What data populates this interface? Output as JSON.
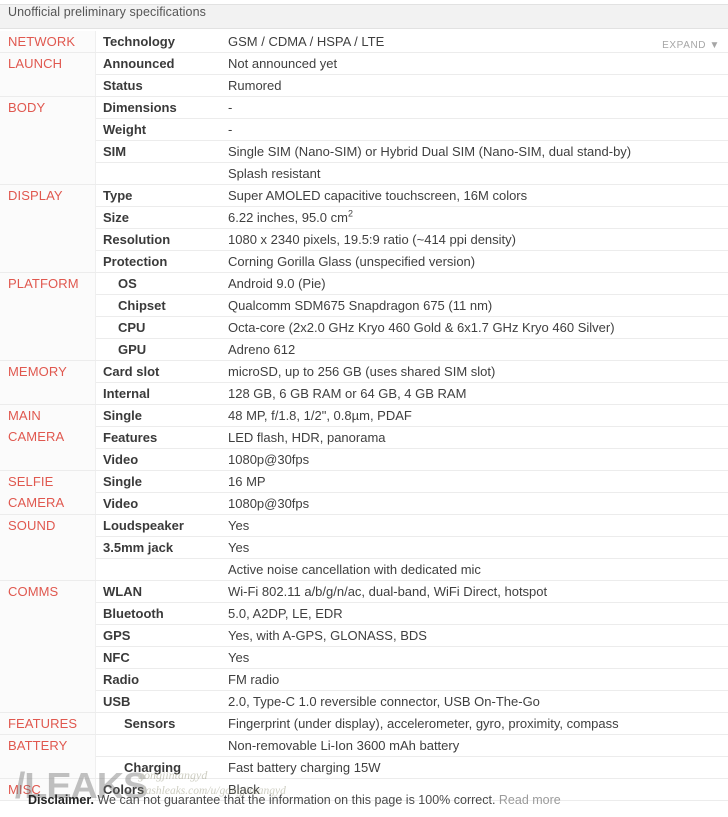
{
  "header": {
    "title": "Unofficial preliminary specifications",
    "expand_label": "EXPAND ▼"
  },
  "colors": {
    "category_red": "#e0584f",
    "header_bg": "#f2f2f2",
    "row_divider": "#ececec",
    "link_grey": "#9b9b9b"
  },
  "sections": [
    {
      "category": "NETWORK",
      "rows": [
        {
          "label": "Technology",
          "value": "GSM / CDMA / HSPA / LTE"
        }
      ]
    },
    {
      "category": "LAUNCH",
      "rows": [
        {
          "label": "Announced",
          "value": "Not announced yet"
        },
        {
          "label": "Status",
          "value": "Rumored"
        }
      ]
    },
    {
      "category": "BODY",
      "rows": [
        {
          "label": "Dimensions",
          "value": "-"
        },
        {
          "label": "Weight",
          "value": "-"
        },
        {
          "label": "SIM",
          "value": "Single SIM (Nano-SIM) or Hybrid Dual SIM (Nano-SIM, dual stand-by)"
        },
        {
          "label": "",
          "value": "Splash resistant"
        }
      ]
    },
    {
      "category": "DISPLAY",
      "rows": [
        {
          "label": "Type",
          "value": "Super AMOLED capacitive touchscreen, 16M colors"
        },
        {
          "label": "Size",
          "value": "6.22 inches, 95.0 cm",
          "superscript": "2"
        },
        {
          "label": "Resolution",
          "value": "1080 x 2340 pixels, 19.5:9 ratio (~414 ppi density)"
        },
        {
          "label": "Protection",
          "value": "Corning Gorilla Glass (unspecified version)"
        }
      ]
    },
    {
      "category": "PLATFORM",
      "rows": [
        {
          "label": "OS",
          "value": "Android 9.0 (Pie)"
        },
        {
          "label": "Chipset",
          "value": "Qualcomm SDM675 Snapdragon 675 (11 nm)"
        },
        {
          "label": "CPU",
          "value": "Octa-core (2x2.0 GHz Kryo 460 Gold & 6x1.7 GHz Kryo 460 Silver)"
        },
        {
          "label": "GPU",
          "value": "Adreno 612"
        }
      ]
    },
    {
      "category": "MEMORY",
      "rows": [
        {
          "label": "Card slot",
          "value": "microSD, up to 256 GB (uses shared SIM slot)"
        },
        {
          "label": "Internal",
          "value": "128 GB, 6 GB RAM or 64 GB, 4 GB RAM"
        }
      ]
    },
    {
      "category": "MAIN CAMERA",
      "rows": [
        {
          "label": "Single",
          "value": "48 MP, f/1.8, 1/2\", 0.8µm, PDAF"
        },
        {
          "label": "Features",
          "value": "LED flash, HDR, panorama"
        },
        {
          "label": "Video",
          "value": "1080p@30fps"
        }
      ]
    },
    {
      "category": "SELFIE CAMERA",
      "rows": [
        {
          "label": "Single",
          "value": "16 MP"
        },
        {
          "label": "Video",
          "value": "1080p@30fps"
        }
      ]
    },
    {
      "category": "SOUND",
      "rows": [
        {
          "label": "Loudspeaker",
          "value": "Yes"
        },
        {
          "label": "3.5mm jack",
          "value": "Yes"
        },
        {
          "label": "",
          "value": "Active noise cancellation with dedicated mic"
        }
      ]
    },
    {
      "category": "COMMS",
      "rows": [
        {
          "label": "WLAN",
          "value": "Wi-Fi 802.11 a/b/g/n/ac, dual-band, WiFi Direct, hotspot"
        },
        {
          "label": "Bluetooth",
          "value": "5.0, A2DP, LE, EDR"
        },
        {
          "label": "GPS",
          "value": "Yes, with A-GPS, GLONASS, BDS"
        },
        {
          "label": "NFC",
          "value": "Yes"
        },
        {
          "label": "Radio",
          "value": "FM radio"
        },
        {
          "label": "USB",
          "value": "2.0, Type-C 1.0 reversible connector, USB On-The-Go"
        }
      ]
    },
    {
      "category": "FEATURES",
      "rows": [
        {
          "label": "Sensors",
          "value": "Fingerprint (under display), accelerometer, gyro, proximity, compass"
        }
      ]
    },
    {
      "category": "BATTERY",
      "rows": [
        {
          "label": "",
          "value": "Non-removable Li-Ion 3600 mAh battery"
        },
        {
          "label": "Charging",
          "value": "Fast battery charging 15W"
        }
      ]
    },
    {
      "category": "MISC",
      "rows": [
        {
          "label": "Colors",
          "value": "Black"
        }
      ]
    }
  ],
  "watermark": {
    "logo": "/LEAKS",
    "user": "gongjintangyd",
    "url": "slashleaks.com/u/gongjintangyd"
  },
  "disclaimer": {
    "bold": "Disclaimer.",
    "text": " We can not guarantee that the information on this page is 100% correct. ",
    "link": "Read more"
  }
}
